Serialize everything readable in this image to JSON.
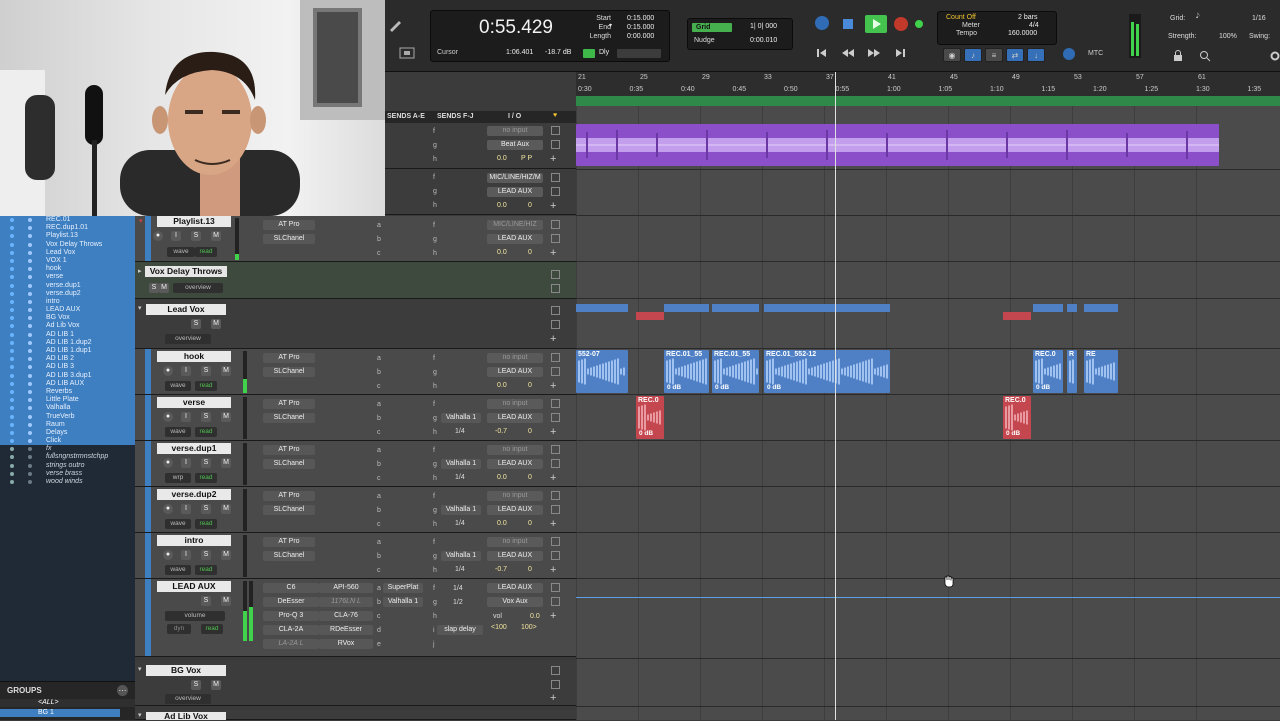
{
  "transport": {
    "main_counter": "0:55.429",
    "start_label": "Start",
    "end_label": "End",
    "length_label": "Length",
    "start_value": "0:15.000",
    "end_value": "0:15.000",
    "length_value": "0:00.000",
    "cursor_label": "Cursor",
    "cursor_value": "1:06.401",
    "db_value": "-18.7 dB",
    "dly_label": "Dly",
    "grid_badge": "Grid",
    "grid_value": "1| 0| 000",
    "nudge_label": "Nudge",
    "nudge_value": "0:00.010",
    "count_off": "Count Off",
    "meter_label": "Meter",
    "tempo_label": "Tempo",
    "count_off_value": "2 bars",
    "meter_value": "4/4",
    "tempo_value": "160.0000",
    "mtc_label": "MTC",
    "grid_right_label": "Grid:",
    "grid_right_value": "1/16",
    "strength_label": "Strength:",
    "strength_value": "100%",
    "swing_label": "Swing:"
  },
  "mix_header": {
    "sends_ae": "SENDS A-E",
    "sends_fj": "SENDS F-J",
    "io": "I / O"
  },
  "left_tracks": [
    {
      "label": "REC.01",
      "style": "sel"
    },
    {
      "label": "REC.dup1.01",
      "style": "sel"
    },
    {
      "label": "Playlist.13",
      "style": "sel"
    },
    {
      "label": "Vox Delay Throws",
      "style": "sel"
    },
    {
      "label": "Lead Vox",
      "style": "sel"
    },
    {
      "label": "VOX 1",
      "style": "sel"
    },
    {
      "label": "hook",
      "style": "sel"
    },
    {
      "label": "verse",
      "style": "sel"
    },
    {
      "label": "verse.dup1",
      "style": "sel"
    },
    {
      "label": "verse.dup2",
      "style": "sel"
    },
    {
      "label": "intro",
      "style": "sel"
    },
    {
      "label": "LEAD AUX",
      "style": "sel"
    },
    {
      "label": "BG Vox",
      "style": "sel"
    },
    {
      "label": "Ad Lib Vox",
      "style": "sel"
    },
    {
      "label": "AD LIB 1",
      "style": "sel"
    },
    {
      "label": "AD LIB 1.dup2",
      "style": "sel"
    },
    {
      "label": "AD LIB 1.dup1",
      "style": "sel"
    },
    {
      "label": "AD LIB 2",
      "style": "sel"
    },
    {
      "label": "AD LIB 3",
      "style": "sel"
    },
    {
      "label": "AD LIB 3.dup1",
      "style": "sel"
    },
    {
      "label": "AD LIB AUX",
      "style": "sel"
    },
    {
      "label": "Reverbs",
      "style": "sel"
    },
    {
      "label": "Little Plate",
      "style": "sel"
    },
    {
      "label": "Valhalla",
      "style": "sel"
    },
    {
      "label": "TrueVerb",
      "style": "sel"
    },
    {
      "label": "Raum",
      "style": "sel"
    },
    {
      "label": "Delays",
      "style": "sel"
    },
    {
      "label": "Click",
      "style": "sel"
    },
    {
      "label": "fx",
      "style": "plain"
    },
    {
      "label": "fullsngnstrmnstchpp",
      "style": "plain"
    },
    {
      "label": "strings outro",
      "style": "plain"
    },
    {
      "label": "verse brass",
      "style": "plain"
    },
    {
      "label": "wood winds",
      "style": "plain"
    }
  ],
  "groups": {
    "title": "GROUPS",
    "all": "<ALL>",
    "bg": "BG 1"
  },
  "rows": {
    "top1": {
      "io_in": "no input",
      "io_out": "Beat Aux",
      "vol": "0.0",
      "pan": "P  P"
    },
    "top2": {
      "io_in": "MIC/LINE/HIZ/M",
      "io_out": "LEAD AUX",
      "vol": "0.0",
      "pan": "0"
    }
  },
  "tracks": {
    "playlist": {
      "name": "Playlist.13",
      "ins1": "AT Pro",
      "ins2": "SLChanel",
      "wave": "wave",
      "read": "read",
      "io_in": "MIC/LINE/HIZ",
      "io_out": "LEAD AUX",
      "vol": "0.0",
      "pan": "0"
    },
    "vdt": {
      "name": "Vox Delay Throws",
      "view": "overview"
    },
    "leadvox": {
      "name": "Lead Vox",
      "view": "overview"
    },
    "hook": {
      "name": "hook",
      "ins1": "AT Pro",
      "ins2": "SLChanel",
      "wave": "wave",
      "read": "read",
      "io_in": "no input",
      "io_out": "LEAD AUX",
      "vol": "0.0",
      "pan": "0"
    },
    "verse": {
      "name": "verse",
      "ins1": "AT Pro",
      "ins2": "SLChanel",
      "wave": "wave",
      "read": "read",
      "send": "Valhalla 1",
      "send_val": "1/4",
      "io_in": "no input",
      "io_out": "LEAD AUX",
      "vol": "-0.7",
      "pan": "0"
    },
    "verse1": {
      "name": "verse.dup1",
      "ins1": "AT Pro",
      "ins2": "SLChanel",
      "wave": "wrp",
      "read": "read",
      "send": "Valhalla 1",
      "send_val": "1/4",
      "io_in": "no input",
      "io_out": "LEAD AUX",
      "vol": "0.0",
      "pan": "0"
    },
    "verse2": {
      "name": "verse.dup2",
      "ins1": "AT Pro",
      "ins2": "SLChanel",
      "wave": "wave",
      "read": "read",
      "send": "Valhalla 1",
      "send_val": "1/4",
      "io_in": "no input",
      "io_out": "LEAD AUX",
      "vol": "0.0",
      "pan": "0"
    },
    "intro": {
      "name": "intro",
      "ins1": "AT Pro",
      "ins2": "SLChanel",
      "wave": "wave",
      "read": "read",
      "send": "Valhalla 1",
      "send_val": "1/4",
      "io_in": "no input",
      "io_out": "LEAD AUX",
      "vol": "-0.7",
      "pan": "0"
    },
    "leadaux": {
      "name": "LEAD AUX",
      "view": "volume",
      "dyn": "dyn",
      "read": "read",
      "insA": [
        "C6",
        "DeEsser",
        "Pro-Q 3",
        "CLA-2A",
        "LA-2A L"
      ],
      "insB": [
        "API-560",
        "1176LN L",
        "CLA-76",
        "RDeEsser",
        "RVox"
      ],
      "sendsA": [
        "SuperPlat",
        "Valhalla 1"
      ],
      "sendsF": [
        "1/4",
        "1/2",
        "slap delay"
      ],
      "io_in": "LEAD AUX",
      "io_out": "Vox Aux",
      "vol_label": "vol",
      "vol": "0.0",
      "pan_l": "<100",
      "pan_r": "100>"
    },
    "bgvox": {
      "name": "BG Vox",
      "view": "overview"
    },
    "adlib": {
      "name": "Ad Lib Vox"
    }
  },
  "ruler": {
    "bars": [
      "21",
      "25",
      "29",
      "33",
      "37",
      "41",
      "45",
      "49",
      "53",
      "57",
      "61"
    ],
    "times": [
      "0:30",
      "0:35",
      "0:40",
      "0:45",
      "0:50",
      "0:55",
      "1:00",
      "1:05",
      "1:10",
      "1:15",
      "1:20",
      "1:25",
      "1:30",
      "1:35"
    ]
  },
  "clips": {
    "hook": [
      "552-07",
      "REC.01_55",
      "REC.01_55",
      "REC.01_552-12",
      "REC.0",
      "R",
      "RE"
    ],
    "hook_db": [
      "0 dB",
      "0 dB",
      "0 dB",
      "0 dB"
    ],
    "verse": [
      "REC.0",
      "REC.0"
    ],
    "verse_db": [
      "0 dB",
      "0 dB"
    ]
  },
  "colors": {
    "accent": "#3d7fc0",
    "purple": "#8b4fc9",
    "clip_blue": "#4f7fc4",
    "clip_red": "#c4474f",
    "meter": "#3fd24a"
  }
}
